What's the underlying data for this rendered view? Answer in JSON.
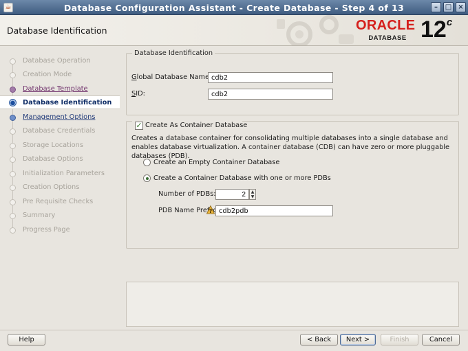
{
  "window": {
    "title": "Database Configuration Assistant - Create Database - Step 4 of 13",
    "buttons": [
      "minimize",
      "maximize",
      "close"
    ]
  },
  "header": {
    "page_title": "Database Identification",
    "logo_brand": "ORACLE",
    "logo_sub": "DATABASE",
    "version": "12",
    "version_sup": "c"
  },
  "sidebar": {
    "steps": [
      {
        "label": "Database Operation",
        "state": "done"
      },
      {
        "label": "Creation Mode",
        "state": "done"
      },
      {
        "label": "Database Template",
        "state": "visited"
      },
      {
        "label": "Database Identification",
        "state": "current"
      },
      {
        "label": "Management Options",
        "state": "link"
      },
      {
        "label": "Database Credentials",
        "state": "pending"
      },
      {
        "label": "Storage Locations",
        "state": "pending"
      },
      {
        "label": "Database Options",
        "state": "pending"
      },
      {
        "label": "Initialization Parameters",
        "state": "pending"
      },
      {
        "label": "Creation Options",
        "state": "pending"
      },
      {
        "label": "Pre Requisite Checks",
        "state": "pending"
      },
      {
        "label": "Summary",
        "state": "pending"
      },
      {
        "label": "Progress Page",
        "state": "pending"
      }
    ]
  },
  "identification": {
    "legend": "Database Identification",
    "global_name_label_mnemonic": "G",
    "global_name_label_rest": "lobal Database Name:",
    "global_name_value": "cdb2",
    "sid_label_mnemonic": "S",
    "sid_label_rest": "ID:",
    "sid_value": "cdb2"
  },
  "container": {
    "checkbox_label": "Create As Container Database",
    "checked": true,
    "description": "Creates a database container for consolidating multiple databases into a single database and enables database virtualization. A container database (CDB) can have zero or more pluggable databases (PDB).",
    "option_empty": "Create an Empty Container Database",
    "option_with_pdbs": "Create a Container Database with one or more PDBs",
    "selected_option": "with_pdbs",
    "num_pdbs_label": "Number of PDBs:",
    "num_pdbs_value": "2",
    "pdb_prefix_label": "PDB Name Prefix:",
    "pdb_prefix_value": "cdb2pdb"
  },
  "footer": {
    "help": "Help",
    "back": "< Back",
    "next": "Next >",
    "finish": "Finish",
    "cancel": "Cancel"
  },
  "colors": {
    "titlebar": "#3f5c80",
    "oracle_red": "#d5201c",
    "current_step": "#0f2d66",
    "visited_step": "#72356e"
  }
}
